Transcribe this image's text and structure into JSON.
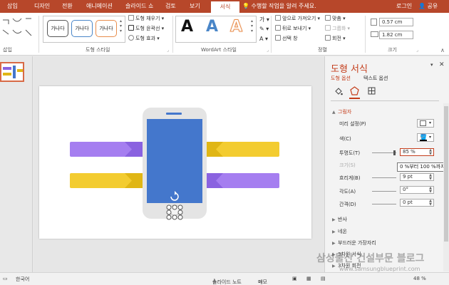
{
  "tabs": [
    {
      "label": "삽입"
    },
    {
      "label": "디자인"
    },
    {
      "label": "전환"
    },
    {
      "label": "애니메이션"
    },
    {
      "label": "슬라이드 쇼"
    },
    {
      "label": "검토"
    },
    {
      "label": "보기"
    },
    {
      "label": "서식"
    }
  ],
  "active_tab": "서식",
  "tell_me": "수행할 작업을 알려 주세요.",
  "account": {
    "login": "로그인",
    "share": "공유"
  },
  "ribbon": {
    "insert_group_label": "삽입",
    "shape_style_label": "도형 스타일",
    "wordart_label": "WordArt 스타일",
    "arrange_label": "정렬",
    "size_label": "크기",
    "style_samples": [
      "가나다",
      "가나다",
      "가나다"
    ],
    "shape_fill": "도형 채우기",
    "shape_outline": "도형 윤곽선",
    "shape_effect": "도형 효과",
    "wordart_sample": "A",
    "bring_forward": "앞으로 가져오기",
    "send_backward": "뒤로 보내기",
    "selection_pane": "선택 창",
    "align": "맞춤",
    "group": "그룹화",
    "rotate": "회전",
    "height": "0.57 cm",
    "width": "1.82 cm",
    "colors": {
      "accent": "#b7472a",
      "wa_blue": "#4a86c8",
      "wa_orange": "#e88d4c"
    }
  },
  "slide": {
    "colors": {
      "purple": "#a57ef0",
      "purple_dark": "#8a62e0",
      "yellow": "#f3cc30",
      "yellow_dark": "#e0b615",
      "phone_frame": "#e4e4e4",
      "phone_screen": "#4477cc"
    }
  },
  "pane": {
    "title": "도형 서식",
    "subtabs": [
      "도형 옵션",
      "텍스트 옵션"
    ],
    "section_shadow": "그림자",
    "props": {
      "presets": "미리 설정(P)",
      "color": "색(C)",
      "transparency": "투명도(T)",
      "size": "크기(S)",
      "blur": "흐리게(B)",
      "angle": "각도(A)",
      "distance": "간격(D)"
    },
    "values": {
      "transparency": "85 %",
      "blur": "9 pt",
      "angle": "0°",
      "distance": "0 pt"
    },
    "tooltip": "0 %부터 100 %까지",
    "sections": [
      "반사",
      "네온",
      "부드러운 가장자리",
      "3차원 서식",
      "3차원 회전"
    ]
  },
  "status": {
    "language": "한국어",
    "notes": "슬라이드 노트",
    "comments": "메모",
    "zoom": "48 %"
  },
  "watermark": {
    "line1": "삼성물산 건설부문 블로그",
    "line2": "www.samsungblueprint.com"
  }
}
